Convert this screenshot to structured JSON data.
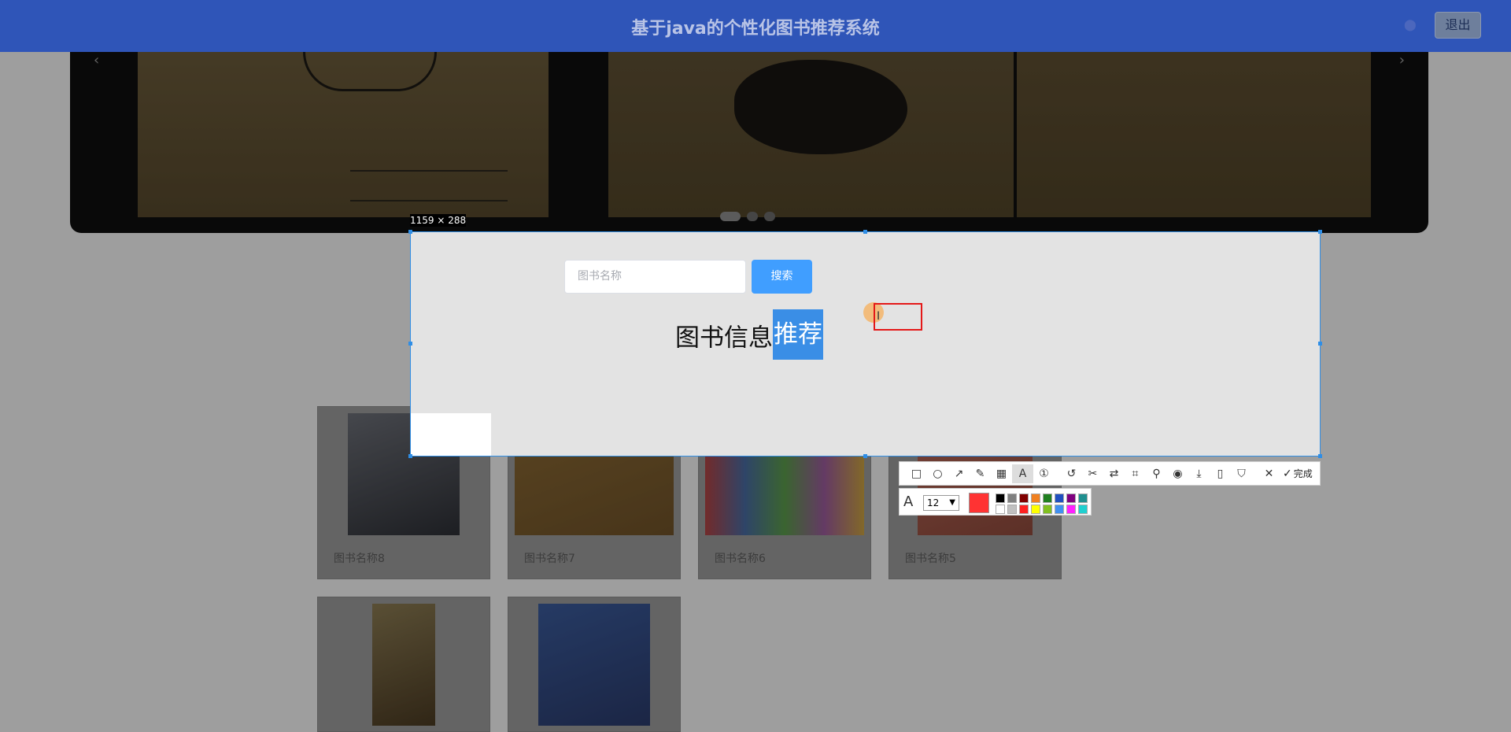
{
  "header": {
    "title": "基于java的个性化图书推荐系统",
    "exit_label": "退出"
  },
  "carousel": {
    "prev_icon": "‹",
    "next_icon": "›",
    "slide_count": 3,
    "active_slide": 1
  },
  "search": {
    "placeholder": "图书名称",
    "button_label": "搜索"
  },
  "section": {
    "title_plain": "图书信息",
    "title_selected": "推荐"
  },
  "books": [
    {
      "name": "图书名称8"
    },
    {
      "name": "图书名称7"
    },
    {
      "name": "图书名称6"
    },
    {
      "name": "图书名称5"
    },
    {
      "name": "",
      "note": "second row"
    },
    {
      "name": ""
    }
  ],
  "screenshot_tool": {
    "size_label": "1159 × 288",
    "done_label": "完成",
    "font_size": "12",
    "current_color": "#ff3333",
    "palette": [
      "#000000",
      "#808080",
      "#800000",
      "#f08020",
      "#208020",
      "#2050c0",
      "#800080",
      "#209090",
      "#ffffff",
      "#c0c0c0",
      "#ff2020",
      "#ffff00",
      "#80c020",
      "#4090f0",
      "#ff20ff",
      "#20d0d0"
    ]
  },
  "colors": {
    "header_bg": "#2f55b8",
    "primary_button": "#409eff",
    "selection": "#3a8ee6",
    "capture_border": "#2f8ee6"
  }
}
